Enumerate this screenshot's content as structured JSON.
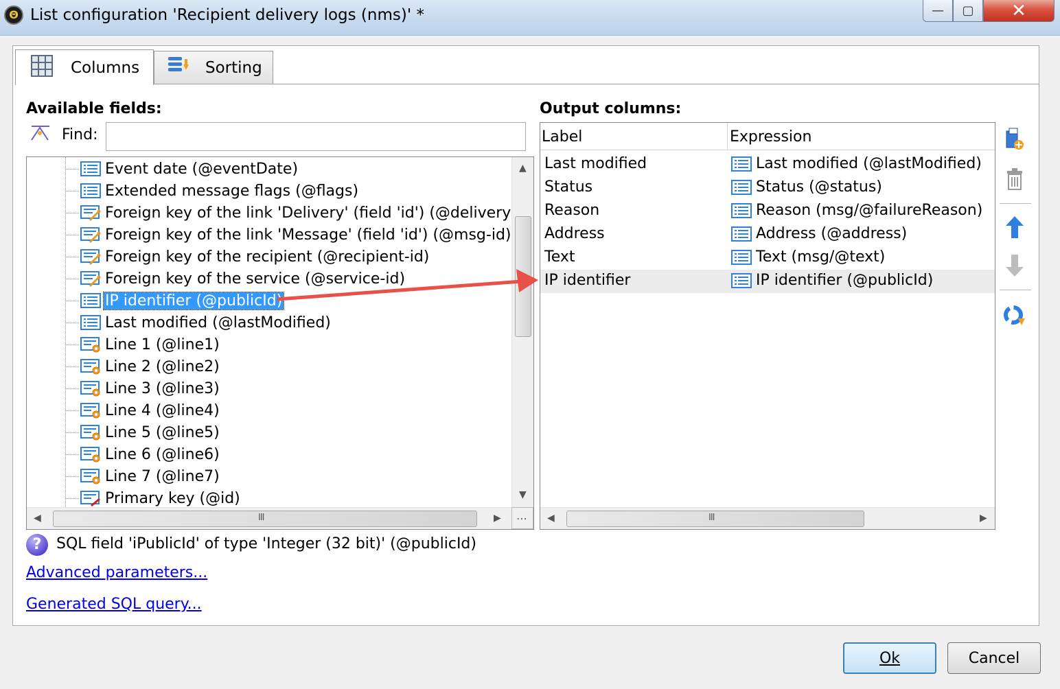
{
  "window": {
    "title": "List configuration 'Recipient delivery logs (nms)' *",
    "app_icon_glyph": "Θ",
    "minimize_glyph": "—",
    "maximize_glyph": "▢",
    "close_glyph": "✕"
  },
  "tabs": [
    {
      "label": "Columns",
      "icon": "grid-icon",
      "active": true
    },
    {
      "label": "Sorting",
      "icon": "sort-icon",
      "active": false
    }
  ],
  "available": {
    "heading": "Available fields:",
    "find_label": "Find:",
    "find_value": "",
    "items": [
      {
        "label": "Event date (@eventDate)",
        "icon": "field-icon"
      },
      {
        "label": "Extended message flags (@flags)",
        "icon": "field-icon"
      },
      {
        "label": "Foreign key of the link 'Delivery' (field 'id') (@delivery-id",
        "icon": "foreign-key-icon"
      },
      {
        "label": "Foreign key of the link 'Message' (field 'id') (@msg-id)",
        "icon": "foreign-key-icon"
      },
      {
        "label": "Foreign key of the recipient (@recipient-id)",
        "icon": "foreign-key-icon"
      },
      {
        "label": "Foreign key of the service (@service-id)",
        "icon": "foreign-key-icon"
      },
      {
        "label": "IP identifier (@publicId)",
        "icon": "field-icon",
        "selected": true
      },
      {
        "label": "Last modified (@lastModified)",
        "icon": "field-icon"
      },
      {
        "label": "Line 1 (@line1)",
        "icon": "computed-field-icon"
      },
      {
        "label": "Line 2 (@line2)",
        "icon": "computed-field-icon"
      },
      {
        "label": "Line 3 (@line3)",
        "icon": "computed-field-icon"
      },
      {
        "label": "Line 4 (@line4)",
        "icon": "computed-field-icon"
      },
      {
        "label": "Line 5 (@line5)",
        "icon": "computed-field-icon"
      },
      {
        "label": "Line 6 (@line6)",
        "icon": "computed-field-icon"
      },
      {
        "label": "Line 7 (@line7)",
        "icon": "computed-field-icon"
      },
      {
        "label": "Primary key (@id)",
        "icon": "primary-key-icon"
      }
    ]
  },
  "output": {
    "heading": "Output columns:",
    "col_label": "Label",
    "col_expression": "Expression",
    "rows": [
      {
        "label": "Last modified",
        "expression": "Last modified (@lastModified)"
      },
      {
        "label": "Status",
        "expression": "Status (@status)"
      },
      {
        "label": "Reason",
        "expression": "Reason (msg/@failureReason)"
      },
      {
        "label": "Address",
        "expression": "Address (@address)"
      },
      {
        "label": "Text",
        "expression": "Text (msg/@text)"
      },
      {
        "label": "IP identifier",
        "expression": "IP identifier (@publicId)",
        "selected": true
      }
    ]
  },
  "side_toolbar": [
    "add-column-icon",
    "delete-icon",
    "move-up-icon",
    "move-down-icon",
    "distribution-icon"
  ],
  "help": {
    "glyph": "?",
    "text": "SQL field 'iPublicId' of type 'Integer (32 bit)' (@publicId)"
  },
  "links": {
    "advanced": "Advanced parameters...",
    "sql": "Generated SQL query..."
  },
  "scroll_glyphs": {
    "left": "◀",
    "right": "▶",
    "up": "▲",
    "down": "▼",
    "grip": "III",
    "more": "⋯"
  },
  "buttons": {
    "ok": "Ok",
    "cancel": "Cancel"
  },
  "colors": {
    "selection": "#3399ff",
    "annotation_arrow": "#e8514a",
    "link": "#0000ee"
  }
}
